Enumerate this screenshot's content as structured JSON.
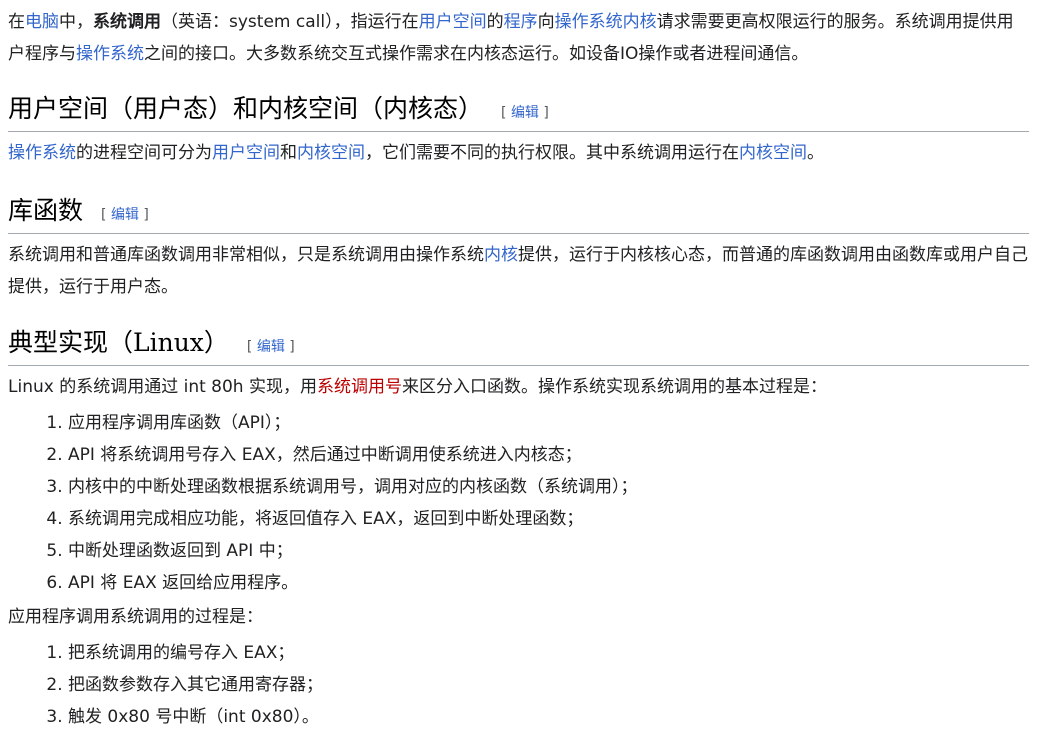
{
  "intro": {
    "t1": "在",
    "link_computer": "电脑",
    "t2": "中，",
    "bold_term": "系统调用",
    "t3": "（英语：system call），指运行在",
    "link_user_space": "用户空间",
    "t4": "的",
    "link_program": "程序",
    "t5": "向",
    "link_os_kernel": "操作系统内核",
    "t6": "请求需要更高权限运行的服务。系统调用提供用户程序与",
    "link_os": "操作系统",
    "t7": "之间的接口。大多数系统交互式操作需求在内核态运行。如设备IO操作或者进程间通信。"
  },
  "section1": {
    "heading": "用户空间（用户态）和内核空间（内核态）",
    "edit_open": "[ ",
    "edit_label": "编辑",
    "edit_close": " ]",
    "link_os": "操作系统",
    "t1": "的进程空间可分为",
    "link_user_space": "用户空间",
    "t2": "和",
    "link_kernel_space": "内核空间",
    "t3": "，它们需要不同的执行权限。其中系统调用运行在",
    "link_kernel_space2": "内核空间",
    "t4": "。"
  },
  "section2": {
    "heading": "库函数",
    "edit_open": "[ ",
    "edit_label": "编辑",
    "edit_close": " ]",
    "t1": "系统调用和普通库函数调用非常相似，只是系统调用由操作系统",
    "link_kernel": "内核",
    "t2": "提供，运行于内核核心态，而普通的库函数调用由函数库或用户自己提供，运行于用户态。"
  },
  "section3": {
    "heading": "典型实现（Linux）",
    "edit_open": "[ ",
    "edit_label": "编辑",
    "edit_close": " ]",
    "t1": "Linux 的系统调用通过 int 80h 实现，用",
    "link_syscall_number": "系统调用号",
    "t2": "来区分入口函数。操作系统实现系统调用的基本过程是：",
    "steps": [
      "应用程序调用库函数（API）；",
      "API 将系统调用号存入 EAX，然后通过中断调用使系统进入内核态；",
      "内核中的中断处理函数根据系统调用号，调用对应的内核函数（系统调用）；",
      "系统调用完成相应功能，将返回值存入 EAX，返回到中断处理函数；",
      "中断处理函数返回到 API 中；",
      "API 将 EAX 返回给应用程序。"
    ],
    "t3": "应用程序调用系统调用的过程是：",
    "steps2": [
      "把系统调用的编号存入 EAX；",
      "把函数参数存入其它通用寄存器；",
      "触发 0x80 号中断（int 0x80）。"
    ]
  },
  "colors": {
    "link": "#3366cc",
    "new_link": "#ba0000",
    "text": "#202122",
    "rule": "#a2a9b1"
  }
}
